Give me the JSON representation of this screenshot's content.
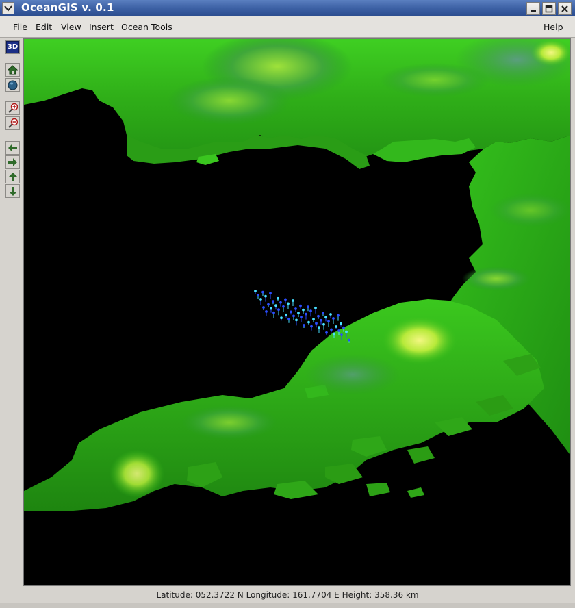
{
  "window": {
    "title": "OceanGIS v. 0.1",
    "controls": {
      "minimize_icon": "minimize-icon",
      "maximize_icon": "maximize-icon",
      "close_icon": "close-icon"
    }
  },
  "menubar": {
    "items": [
      {
        "label": "File"
      },
      {
        "label": "Edit"
      },
      {
        "label": "View"
      },
      {
        "label": "Insert"
      },
      {
        "label": "Ocean Tools"
      }
    ],
    "help": "Help"
  },
  "toolbar": {
    "mode_3d": "3D",
    "tools": [
      "home-icon",
      "globe-icon",
      "zoom-in-icon",
      "zoom-out-icon",
      "pan-left-icon",
      "pan-right-icon",
      "pan-up-icon",
      "pan-down-icon"
    ]
  },
  "colors": {
    "terrain_low": "#1f8a12",
    "terrain_mid": "#39c21c",
    "terrain_high": "#c9ee3c",
    "ocean_background": "#000000",
    "data_point_deep": "#2a4dff",
    "data_point_shallow": "#48e0ff",
    "titlebar": "#3b5fa3"
  },
  "statusbar": {
    "text": "Latitude: 052.3722 N Longitude: 161.7704 E Height: 358.36 km"
  }
}
